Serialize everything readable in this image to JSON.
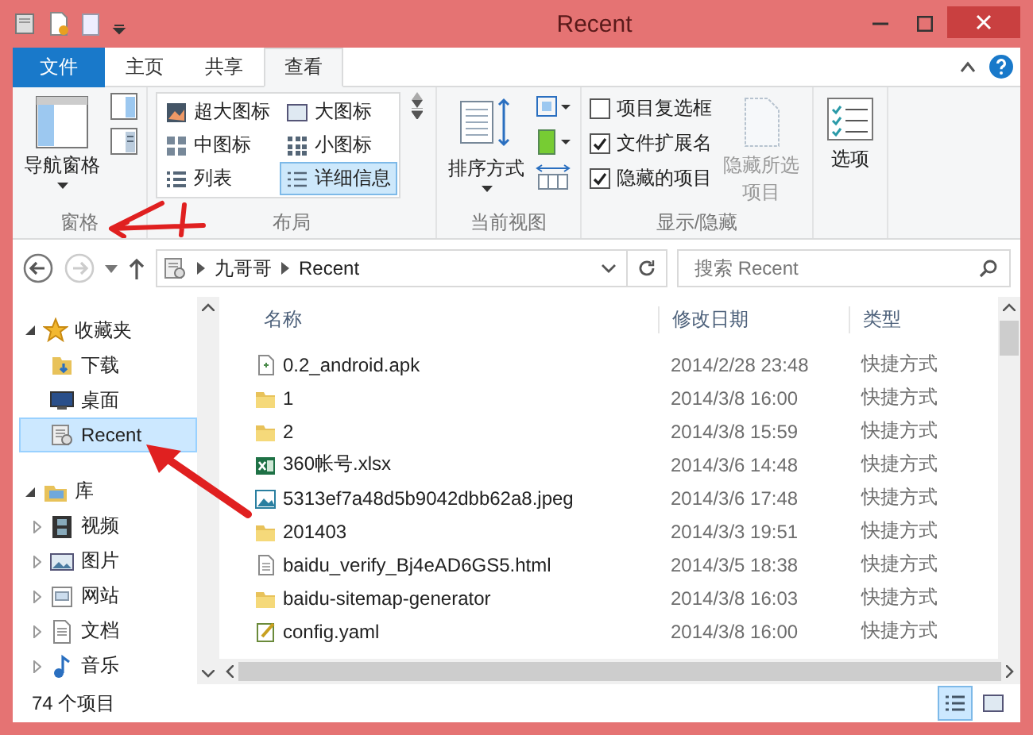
{
  "window": {
    "title": "Recent"
  },
  "ribbon_tabs": [
    {
      "label": "文件",
      "kind": "file",
      "selected": false
    },
    {
      "label": "主页",
      "kind": "tab",
      "selected": false
    },
    {
      "label": "共享",
      "kind": "tab",
      "selected": false
    },
    {
      "label": "查看",
      "kind": "tab",
      "selected": true
    }
  ],
  "ribbon_groups": [
    {
      "label": "窗格",
      "kind": "panes",
      "button": "导航窗格"
    },
    {
      "label": "布局",
      "kind": "layout",
      "options": [
        {
          "label": "超大图标",
          "selected": false
        },
        {
          "label": "大图标",
          "selected": false
        },
        {
          "label": "中图标",
          "selected": false
        },
        {
          "label": "小图标",
          "selected": false
        },
        {
          "label": "列表",
          "selected": false
        },
        {
          "label": "详细信息",
          "selected": true
        }
      ]
    },
    {
      "label": "当前视图",
      "kind": "view",
      "button": "排序方式"
    },
    {
      "label": "显示/隐藏",
      "kind": "show",
      "checkboxes": [
        {
          "label": "项目复选框",
          "checked": false
        },
        {
          "label": "文件扩展名",
          "checked": true
        },
        {
          "label": "隐藏的项目",
          "checked": true
        }
      ],
      "button": "隐藏所选项目",
      "disabled": true
    },
    {
      "kind": "options",
      "button": "选项"
    }
  ],
  "address": {
    "crumbs": [
      "九哥哥",
      "Recent"
    ],
    "search_placeholder": "搜索 Recent"
  },
  "nav": [
    {
      "label": "收藏夹",
      "expanded": true,
      "selected": false,
      "children": [
        {
          "label": "下载",
          "selected": false
        },
        {
          "label": "桌面",
          "selected": false
        },
        {
          "label": "Recent",
          "selected": true
        }
      ]
    },
    {
      "label": "库",
      "expanded": true,
      "selected": false,
      "children": [
        {
          "label": "视频",
          "expanded": false,
          "selected": false
        },
        {
          "label": "图片",
          "expanded": false,
          "selected": false
        },
        {
          "label": "网站",
          "expanded": false,
          "selected": false
        },
        {
          "label": "文档",
          "expanded": false,
          "selected": false
        },
        {
          "label": "音乐",
          "expanded": false,
          "selected": false
        }
      ]
    }
  ],
  "columns": [
    "名称",
    "修改日期",
    "类型"
  ],
  "files": [
    {
      "name": "0.2_android.apk",
      "date": "2014/2/28 23:48",
      "type": "快捷方式",
      "kind": "file"
    },
    {
      "name": "1",
      "date": "2014/3/8 16:00",
      "type": "快捷方式",
      "kind": "folder"
    },
    {
      "name": "2",
      "date": "2014/3/8 15:59",
      "type": "快捷方式",
      "kind": "folder"
    },
    {
      "name": "360帐号.xlsx",
      "date": "2014/3/6 14:48",
      "type": "快捷方式",
      "kind": "excel"
    },
    {
      "name": "5313ef7a48d5b9042dbb62a8.jpeg",
      "date": "2014/3/6 17:48",
      "type": "快捷方式",
      "kind": "image"
    },
    {
      "name": "201403",
      "date": "2014/3/3 19:51",
      "type": "快捷方式",
      "kind": "folder"
    },
    {
      "name": "baidu_verify_Bj4eAD6GS5.html",
      "date": "2014/3/5 18:38",
      "type": "快捷方式",
      "kind": "text"
    },
    {
      "name": "baidu-sitemap-generator",
      "date": "2014/3/8 16:03",
      "type": "快捷方式",
      "kind": "folder"
    },
    {
      "name": "config.yaml",
      "date": "2014/3/8 16:00",
      "type": "快捷方式",
      "kind": "config"
    }
  ],
  "status_bar": {
    "count": "74 个项目",
    "views": [
      {
        "kind": "details",
        "selected": true
      },
      {
        "kind": "large",
        "selected": false
      }
    ]
  }
}
